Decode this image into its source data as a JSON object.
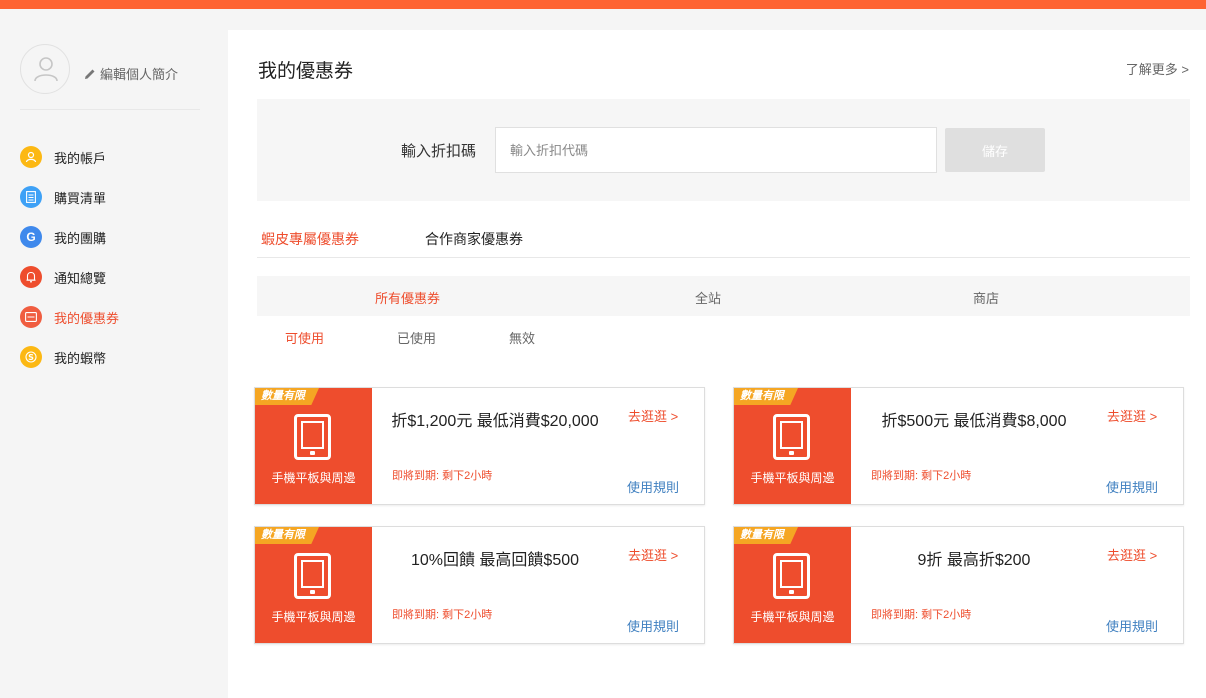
{
  "sidebar": {
    "edit_profile": "編輯個人簡介",
    "items": [
      {
        "label": "我的帳戶",
        "icon": "user-icon",
        "color": "#fcb813",
        "glyph": "♙"
      },
      {
        "label": "購買清單",
        "icon": "list-icon",
        "color": "#3ea1f6",
        "glyph": "≡"
      },
      {
        "label": "我的團購",
        "icon": "group-buy-icon",
        "color": "#3f89ec",
        "glyph": "G"
      },
      {
        "label": "通知總覽",
        "icon": "bell-icon",
        "color": "#ee4d2d",
        "glyph": "♫"
      },
      {
        "label": "我的優惠券",
        "icon": "coupon-icon",
        "color": "#f05d40",
        "glyph": "▤"
      },
      {
        "label": "我的蝦幣",
        "icon": "coin-icon",
        "color": "#fcb813",
        "glyph": "$"
      }
    ]
  },
  "main": {
    "title": "我的優惠券",
    "learn_more": "了解更多 >",
    "code_label": "輸入折扣碼",
    "code_placeholder": "輸入折扣代碼",
    "save_label": "儲存",
    "tabs_primary": [
      "蝦皮專屬優惠券",
      "合作商家優惠券"
    ],
    "tabs_secondary": [
      "所有優惠券",
      "全站",
      "商店"
    ],
    "tabs_status": [
      "可使用",
      "已使用",
      "無效"
    ]
  },
  "coupons": [
    {
      "badge": "數量有限",
      "category": "手機平板與周邊",
      "title": "折$1,200元 最低消費$20,000",
      "expiry": "即將到期: 剩下2小時",
      "shop_label": "去逛逛 >",
      "rules_label": "使用規則"
    },
    {
      "badge": "數量有限",
      "category": "手機平板與周邊",
      "title": "折$500元 最低消費$8,000",
      "expiry": "即將到期: 剩下2小時",
      "shop_label": "去逛逛 >",
      "rules_label": "使用規則"
    },
    {
      "badge": "數量有限",
      "category": "手機平板與周邊",
      "title": "10%回饋 最高回饋$500",
      "expiry": "即將到期: 剩下2小時",
      "shop_label": "去逛逛 >",
      "rules_label": "使用規則"
    },
    {
      "badge": "數量有限",
      "category": "手機平板與周邊",
      "title": "9折 最高折$200",
      "expiry": "即將到期: 剩下2小時",
      "shop_label": "去逛逛 >",
      "rules_label": "使用規則"
    }
  ],
  "colors": {
    "brand": "#ee4d2d",
    "topbar": "#fe6433",
    "badge": "#f5a623",
    "link": "#4080c0"
  }
}
